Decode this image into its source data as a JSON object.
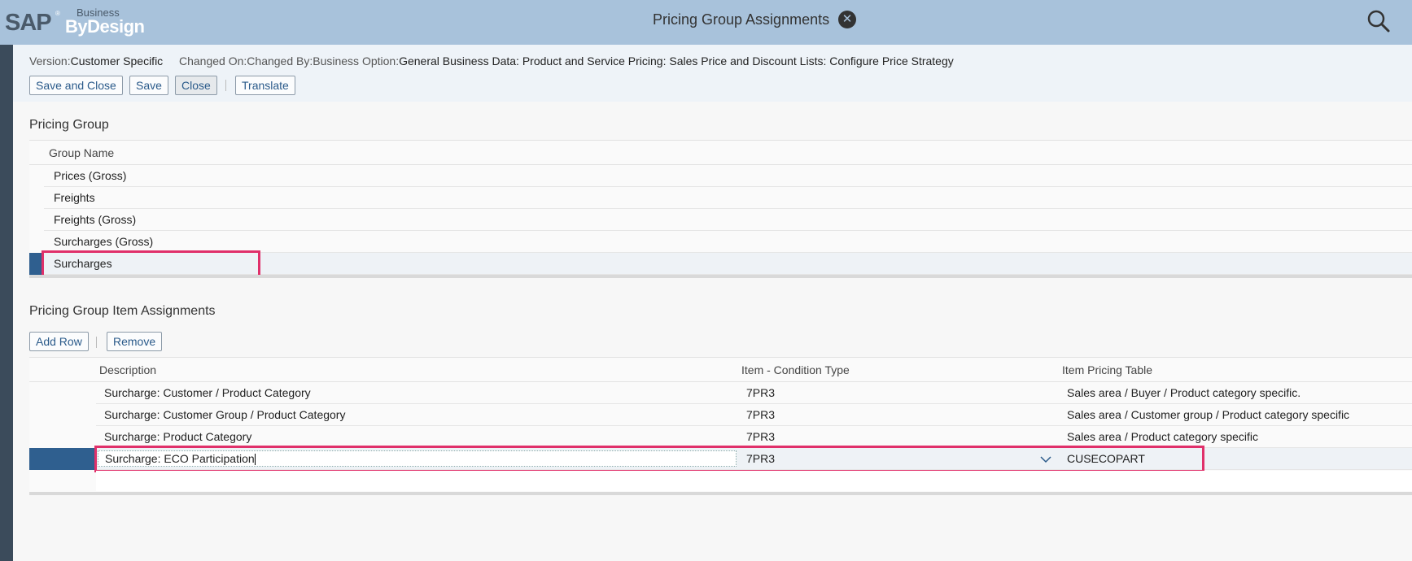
{
  "shell": {
    "logo_sap": "SAP",
    "logo_business": "Business",
    "logo_bydesign": "ByDesign",
    "title": "Pricing Group Assignments",
    "close_glyph": "✕",
    "search_icon": "search-icon"
  },
  "header": {
    "version_label": "Version:",
    "version_value": "Customer Specific",
    "changed_on_label": "Changed On:",
    "changed_by_label": "Changed By:",
    "business_option_label": "Business Option:",
    "business_option_value": "General Business Data: Product and Service Pricing: Sales Price and Discount Lists: Configure Price Strategy"
  },
  "toolbar": {
    "save_and_close": "Save and Close",
    "save": "Save",
    "close": "Close",
    "translate": "Translate"
  },
  "pricing_group": {
    "title": "Pricing Group",
    "column_group_name": "Group Name",
    "rows": [
      "Prices (Gross)",
      "Freights",
      "Freights (Gross)",
      "Surcharges (Gross)",
      "Surcharges"
    ],
    "selected_index": 4
  },
  "item_assignments": {
    "title": "Pricing Group Item Assignments",
    "add_row": "Add Row",
    "remove": "Remove",
    "columns": {
      "description": "Description",
      "condition_type": "Item - Condition Type",
      "pricing_table": "Item Pricing Table"
    },
    "rows": [
      {
        "description": "Surcharge: Customer / Product Category",
        "condition_type": "7PR3",
        "pricing_table": "Sales area / Buyer / Product category specific."
      },
      {
        "description": "Surcharge: Customer Group / Product Category",
        "condition_type": "7PR3",
        "pricing_table": "Sales area / Customer group / Product category specific"
      },
      {
        "description": "Surcharge: Product Category",
        "condition_type": "7PR3",
        "pricing_table": "Sales area  / Product category specific"
      },
      {
        "description": "Surcharge: ECO Participation",
        "condition_type": "7PR3",
        "pricing_table": "CUSECOPART"
      }
    ],
    "selected_index": 3
  },
  "colors": {
    "shell_bg": "#a8c2db",
    "highlight": "#e0306a",
    "selected_marker": "#2f5f8f"
  }
}
